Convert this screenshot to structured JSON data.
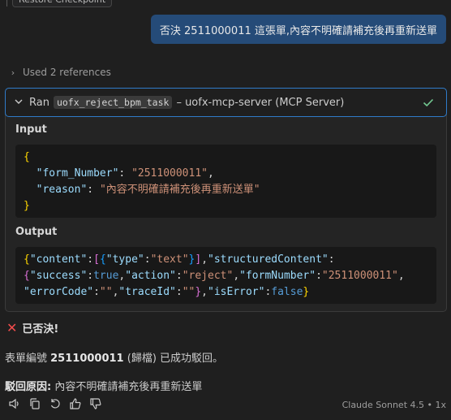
{
  "checkpoint": {
    "label": "Restore Checkpoint"
  },
  "user_message": "否決 2511000011 這張單,內容不明確請補充後再重新送單",
  "references": {
    "label": "Used 2 references"
  },
  "tool_call": {
    "ran_label": "Ran",
    "tool_name": "uofx_reject_bpm_task",
    "server": "– uofx-mcp-server (MCP Server)",
    "input_label": "Input",
    "input": {
      "k1": "\"form_Number\"",
      "v1": "\"2511000011\"",
      "k2": "\"reason\"",
      "v2": "\"內容不明確請補充後再重新送單\""
    },
    "output_label": "Output",
    "output": {
      "k_content": "\"content\"",
      "k_type": "\"type\"",
      "v_type": "\"text\"",
      "k_structured": "\"structuredContent\"",
      "k_success": "\"success\"",
      "v_success": "true",
      "k_action": "\"action\"",
      "v_action": "\"reject\"",
      "k_formNumber": "\"formNumber\"",
      "v_formNumber": "\"2511000011\"",
      "k_errorCode": "\"errorCode\"",
      "v_errorCode": "\"\"",
      "k_traceId": "\"traceId\"",
      "v_traceId": "\"\"",
      "k_isError": "\"isError\"",
      "v_isError": "false"
    }
  },
  "response": {
    "title": "已否決!",
    "line1_prefix": "表單編號 ",
    "line1_number": "2511000011",
    "line1_suffix": " (歸檔) 已成功駁回。",
    "reason_label": "駁回原因:",
    "reason_text": " 內容不明確請補充後再重新送單"
  },
  "footer": {
    "model": "Claude Sonnet 4.5 • 1x"
  },
  "colors": {
    "accent": "#2f7bc9",
    "user_bubble": "#254b78",
    "success": "#73c991",
    "error": "#f14c4c"
  }
}
